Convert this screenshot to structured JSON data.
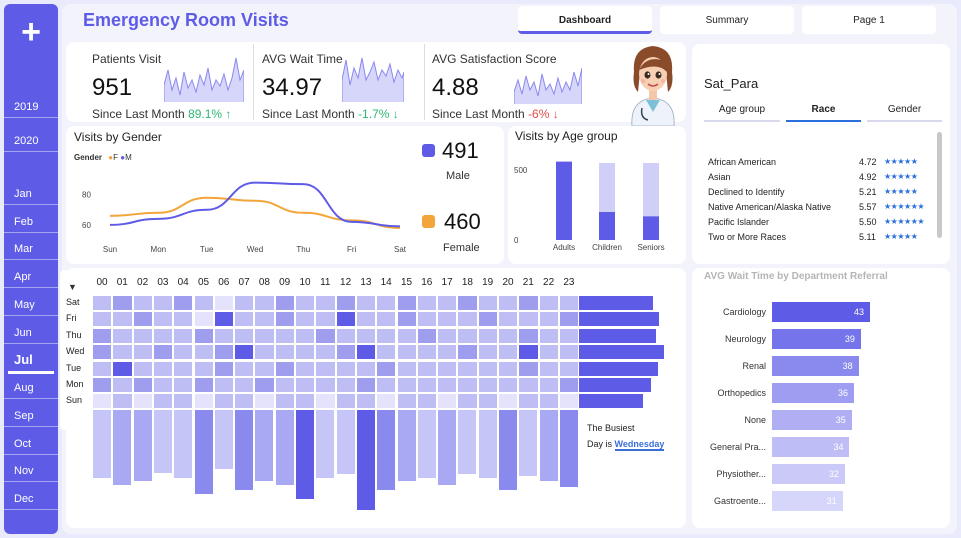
{
  "sidebar": {
    "add_label": "+",
    "years": [
      "2019",
      "2020"
    ],
    "months": [
      "Jan",
      "Feb",
      "Mar",
      "Apr",
      "May",
      "Jun",
      "Jul",
      "Aug",
      "Sep",
      "Oct",
      "Nov",
      "Dec"
    ],
    "active_month": "Jul"
  },
  "header": {
    "title": "Emergency Room Visits",
    "tabs": [
      {
        "label": "Dashboard"
      },
      {
        "label": "Summary"
      },
      {
        "label": "Page 1"
      }
    ],
    "active_tab": "Dashboard"
  },
  "kpis": [
    {
      "label": "Patients Visit",
      "value": "951",
      "since": "Since Last Month",
      "change": "89.1% ↑",
      "trend": "positive"
    },
    {
      "label": "AVG Wait Time",
      "value": "34.97",
      "since": "Since Last Month",
      "change": "-1.7% ↓",
      "trend": "positive"
    },
    {
      "label": "AVG Satisfaction Score",
      "value": "4.88",
      "since": "Since Last Month",
      "change": "-6% ↓",
      "trend": "negative"
    }
  ],
  "gender": {
    "title": "Visits by Gender",
    "legend_title": "Gender",
    "male": {
      "value": "491",
      "label": "Male"
    },
    "female": {
      "value": "460",
      "label": "Female"
    }
  },
  "age": {
    "title": "Visits by Age group"
  },
  "satisfaction": {
    "title": "Sat_Para",
    "tabs": [
      "Age group",
      "Race",
      "Gender"
    ],
    "active_tab": "Race",
    "rows": [
      {
        "name": "African American",
        "value": "4.72",
        "stars": "★★★★★"
      },
      {
        "name": "Asian",
        "value": "4.92",
        "stars": "★★★★★"
      },
      {
        "name": "Declined to Identify",
        "value": "5.21",
        "stars": "★★★★★"
      },
      {
        "name": "Native American/Alaska Native",
        "value": "5.57",
        "stars": "★★★★★★"
      },
      {
        "name": "Pacific Islander",
        "value": "5.50",
        "stars": "★★★★★★"
      },
      {
        "name": "Two or More Races",
        "value": "5.11",
        "stars": "★★★★★"
      }
    ]
  },
  "heatmap": {
    "hours": [
      "00",
      "01",
      "02",
      "03",
      "04",
      "05",
      "06",
      "07",
      "08",
      "09",
      "10",
      "11",
      "12",
      "13",
      "14",
      "15",
      "16",
      "17",
      "18",
      "19",
      "20",
      "21",
      "22",
      "23"
    ],
    "days": [
      "Sat",
      "Fri",
      "Thu",
      "Wed",
      "Tue",
      "Mon",
      "Sun"
    ],
    "busiest_text": "The Busiest",
    "busiest_prefix": "Day is",
    "busiest_day": "Wednesday"
  },
  "chart_data": [
    {
      "type": "line",
      "title": "Visits by Gender",
      "categories": [
        "Sun",
        "Mon",
        "Tue",
        "Wed",
        "Thu",
        "Fri",
        "Sat"
      ],
      "series": [
        {
          "name": "F",
          "color": "#f2a53a",
          "values": [
            66,
            68,
            78,
            76,
            68,
            63,
            58
          ]
        },
        {
          "name": "M",
          "color": "#5e5ce6",
          "values": [
            60,
            64,
            70,
            88,
            87,
            62,
            59
          ]
        }
      ],
      "y_ticks": [
        60,
        80
      ],
      "ylim": [
        50,
        95
      ]
    },
    {
      "type": "bar",
      "title": "Visits by Age group",
      "categories": [
        "Adults",
        "Children",
        "Seniors"
      ],
      "series": [
        {
          "name": "visits",
          "color": "#5e5ce6",
          "values": [
            560,
            200,
            170
          ]
        },
        {
          "name": "remainder",
          "color": "#d0cff7",
          "values": [
            0,
            350,
            380
          ]
        }
      ],
      "y_ticks": [
        0,
        500
      ],
      "ylim": [
        0,
        600
      ]
    },
    {
      "type": "heatmap",
      "rows": [
        "Sat",
        "Fri",
        "Thu",
        "Wed",
        "Tue",
        "Mon",
        "Sun"
      ],
      "cols": [
        "00",
        "01",
        "02",
        "03",
        "04",
        "05",
        "06",
        "07",
        "08",
        "09",
        "10",
        "11",
        "12",
        "13",
        "14",
        "15",
        "16",
        "17",
        "18",
        "19",
        "20",
        "21",
        "22",
        "23"
      ],
      "values": [
        [
          3,
          4,
          3,
          3,
          4,
          3,
          2,
          3,
          3,
          4,
          3,
          3,
          4,
          3,
          3,
          4,
          3,
          3,
          4,
          3,
          3,
          4,
          3,
          3
        ],
        [
          3,
          3,
          4,
          3,
          3,
          2,
          5,
          3,
          3,
          4,
          3,
          3,
          5,
          3,
          3,
          4,
          3,
          3,
          3,
          4,
          3,
          3,
          3,
          4
        ],
        [
          4,
          3,
          3,
          3,
          3,
          4,
          3,
          3,
          3,
          3,
          3,
          4,
          3,
          3,
          3,
          3,
          4,
          3,
          3,
          3,
          3,
          4,
          3,
          3
        ],
        [
          4,
          3,
          3,
          4,
          3,
          3,
          4,
          5,
          3,
          3,
          3,
          3,
          4,
          5,
          3,
          3,
          3,
          3,
          4,
          3,
          3,
          5,
          3,
          3
        ],
        [
          3,
          5,
          3,
          3,
          3,
          3,
          4,
          3,
          3,
          4,
          3,
          3,
          3,
          3,
          4,
          3,
          3,
          3,
          3,
          3,
          3,
          4,
          3,
          3
        ],
        [
          4,
          3,
          4,
          3,
          3,
          4,
          3,
          3,
          4,
          3,
          3,
          3,
          3,
          4,
          3,
          3,
          3,
          3,
          3,
          3,
          3,
          3,
          3,
          4
        ],
        [
          2,
          3,
          2,
          3,
          3,
          2,
          3,
          3,
          2,
          3,
          3,
          2,
          3,
          3,
          2,
          3,
          3,
          2,
          3,
          3,
          2,
          3,
          3,
          2
        ]
      ],
      "row_totals": [
        140,
        150,
        145,
        160,
        148,
        135,
        120
      ],
      "col_totals": [
        38,
        42,
        40,
        35,
        38,
        47,
        33,
        45,
        40,
        42,
        50,
        38,
        36,
        56,
        45,
        40,
        38,
        42,
        36,
        38,
        45,
        37,
        40,
        43
      ]
    },
    {
      "type": "bar",
      "orientation": "horizontal",
      "title": "AVG Wait Time by Department Referral",
      "categories": [
        "Cardiology",
        "Neurology",
        "Renal",
        "Orthopedics",
        "None",
        "General Pra...",
        "Physiother...",
        "Gastroente..."
      ],
      "values": [
        43,
        39,
        38,
        36,
        35,
        34,
        32,
        31
      ],
      "colors": [
        "#5e5ce6",
        "#7574ea",
        "#8a89ee",
        "#9e9df1",
        "#b0aff4",
        "#bebdf6",
        "#cac9f8",
        "#d6d5fa"
      ]
    }
  ]
}
